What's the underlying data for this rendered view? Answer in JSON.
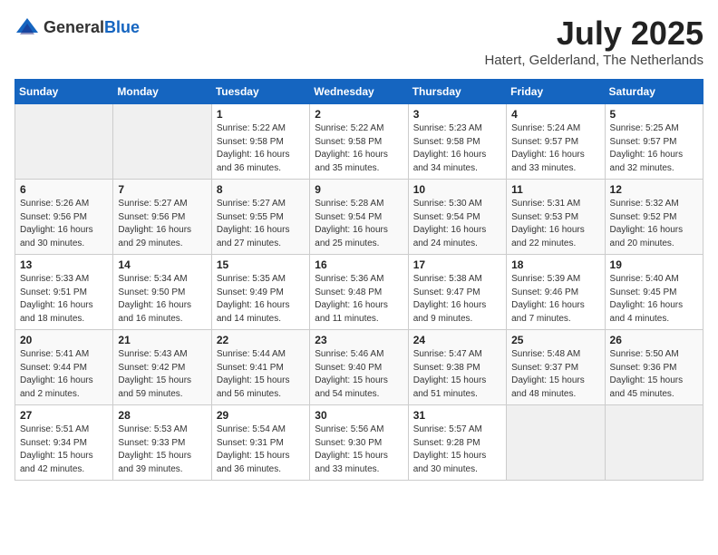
{
  "header": {
    "logo_general": "General",
    "logo_blue": "Blue",
    "month": "July 2025",
    "location": "Hatert, Gelderland, The Netherlands"
  },
  "weekdays": [
    "Sunday",
    "Monday",
    "Tuesday",
    "Wednesday",
    "Thursday",
    "Friday",
    "Saturday"
  ],
  "weeks": [
    [
      {
        "day": "",
        "sunrise": "",
        "sunset": "",
        "daylight": ""
      },
      {
        "day": "",
        "sunrise": "",
        "sunset": "",
        "daylight": ""
      },
      {
        "day": "1",
        "sunrise": "Sunrise: 5:22 AM",
        "sunset": "Sunset: 9:58 PM",
        "daylight": "Daylight: 16 hours and 36 minutes."
      },
      {
        "day": "2",
        "sunrise": "Sunrise: 5:22 AM",
        "sunset": "Sunset: 9:58 PM",
        "daylight": "Daylight: 16 hours and 35 minutes."
      },
      {
        "day": "3",
        "sunrise": "Sunrise: 5:23 AM",
        "sunset": "Sunset: 9:58 PM",
        "daylight": "Daylight: 16 hours and 34 minutes."
      },
      {
        "day": "4",
        "sunrise": "Sunrise: 5:24 AM",
        "sunset": "Sunset: 9:57 PM",
        "daylight": "Daylight: 16 hours and 33 minutes."
      },
      {
        "day": "5",
        "sunrise": "Sunrise: 5:25 AM",
        "sunset": "Sunset: 9:57 PM",
        "daylight": "Daylight: 16 hours and 32 minutes."
      }
    ],
    [
      {
        "day": "6",
        "sunrise": "Sunrise: 5:26 AM",
        "sunset": "Sunset: 9:56 PM",
        "daylight": "Daylight: 16 hours and 30 minutes."
      },
      {
        "day": "7",
        "sunrise": "Sunrise: 5:27 AM",
        "sunset": "Sunset: 9:56 PM",
        "daylight": "Daylight: 16 hours and 29 minutes."
      },
      {
        "day": "8",
        "sunrise": "Sunrise: 5:27 AM",
        "sunset": "Sunset: 9:55 PM",
        "daylight": "Daylight: 16 hours and 27 minutes."
      },
      {
        "day": "9",
        "sunrise": "Sunrise: 5:28 AM",
        "sunset": "Sunset: 9:54 PM",
        "daylight": "Daylight: 16 hours and 25 minutes."
      },
      {
        "day": "10",
        "sunrise": "Sunrise: 5:30 AM",
        "sunset": "Sunset: 9:54 PM",
        "daylight": "Daylight: 16 hours and 24 minutes."
      },
      {
        "day": "11",
        "sunrise": "Sunrise: 5:31 AM",
        "sunset": "Sunset: 9:53 PM",
        "daylight": "Daylight: 16 hours and 22 minutes."
      },
      {
        "day": "12",
        "sunrise": "Sunrise: 5:32 AM",
        "sunset": "Sunset: 9:52 PM",
        "daylight": "Daylight: 16 hours and 20 minutes."
      }
    ],
    [
      {
        "day": "13",
        "sunrise": "Sunrise: 5:33 AM",
        "sunset": "Sunset: 9:51 PM",
        "daylight": "Daylight: 16 hours and 18 minutes."
      },
      {
        "day": "14",
        "sunrise": "Sunrise: 5:34 AM",
        "sunset": "Sunset: 9:50 PM",
        "daylight": "Daylight: 16 hours and 16 minutes."
      },
      {
        "day": "15",
        "sunrise": "Sunrise: 5:35 AM",
        "sunset": "Sunset: 9:49 PM",
        "daylight": "Daylight: 16 hours and 14 minutes."
      },
      {
        "day": "16",
        "sunrise": "Sunrise: 5:36 AM",
        "sunset": "Sunset: 9:48 PM",
        "daylight": "Daylight: 16 hours and 11 minutes."
      },
      {
        "day": "17",
        "sunrise": "Sunrise: 5:38 AM",
        "sunset": "Sunset: 9:47 PM",
        "daylight": "Daylight: 16 hours and 9 minutes."
      },
      {
        "day": "18",
        "sunrise": "Sunrise: 5:39 AM",
        "sunset": "Sunset: 9:46 PM",
        "daylight": "Daylight: 16 hours and 7 minutes."
      },
      {
        "day": "19",
        "sunrise": "Sunrise: 5:40 AM",
        "sunset": "Sunset: 9:45 PM",
        "daylight": "Daylight: 16 hours and 4 minutes."
      }
    ],
    [
      {
        "day": "20",
        "sunrise": "Sunrise: 5:41 AM",
        "sunset": "Sunset: 9:44 PM",
        "daylight": "Daylight: 16 hours and 2 minutes."
      },
      {
        "day": "21",
        "sunrise": "Sunrise: 5:43 AM",
        "sunset": "Sunset: 9:42 PM",
        "daylight": "Daylight: 15 hours and 59 minutes."
      },
      {
        "day": "22",
        "sunrise": "Sunrise: 5:44 AM",
        "sunset": "Sunset: 9:41 PM",
        "daylight": "Daylight: 15 hours and 56 minutes."
      },
      {
        "day": "23",
        "sunrise": "Sunrise: 5:46 AM",
        "sunset": "Sunset: 9:40 PM",
        "daylight": "Daylight: 15 hours and 54 minutes."
      },
      {
        "day": "24",
        "sunrise": "Sunrise: 5:47 AM",
        "sunset": "Sunset: 9:38 PM",
        "daylight": "Daylight: 15 hours and 51 minutes."
      },
      {
        "day": "25",
        "sunrise": "Sunrise: 5:48 AM",
        "sunset": "Sunset: 9:37 PM",
        "daylight": "Daylight: 15 hours and 48 minutes."
      },
      {
        "day": "26",
        "sunrise": "Sunrise: 5:50 AM",
        "sunset": "Sunset: 9:36 PM",
        "daylight": "Daylight: 15 hours and 45 minutes."
      }
    ],
    [
      {
        "day": "27",
        "sunrise": "Sunrise: 5:51 AM",
        "sunset": "Sunset: 9:34 PM",
        "daylight": "Daylight: 15 hours and 42 minutes."
      },
      {
        "day": "28",
        "sunrise": "Sunrise: 5:53 AM",
        "sunset": "Sunset: 9:33 PM",
        "daylight": "Daylight: 15 hours and 39 minutes."
      },
      {
        "day": "29",
        "sunrise": "Sunrise: 5:54 AM",
        "sunset": "Sunset: 9:31 PM",
        "daylight": "Daylight: 15 hours and 36 minutes."
      },
      {
        "day": "30",
        "sunrise": "Sunrise: 5:56 AM",
        "sunset": "Sunset: 9:30 PM",
        "daylight": "Daylight: 15 hours and 33 minutes."
      },
      {
        "day": "31",
        "sunrise": "Sunrise: 5:57 AM",
        "sunset": "Sunset: 9:28 PM",
        "daylight": "Daylight: 15 hours and 30 minutes."
      },
      {
        "day": "",
        "sunrise": "",
        "sunset": "",
        "daylight": ""
      },
      {
        "day": "",
        "sunrise": "",
        "sunset": "",
        "daylight": ""
      }
    ]
  ]
}
